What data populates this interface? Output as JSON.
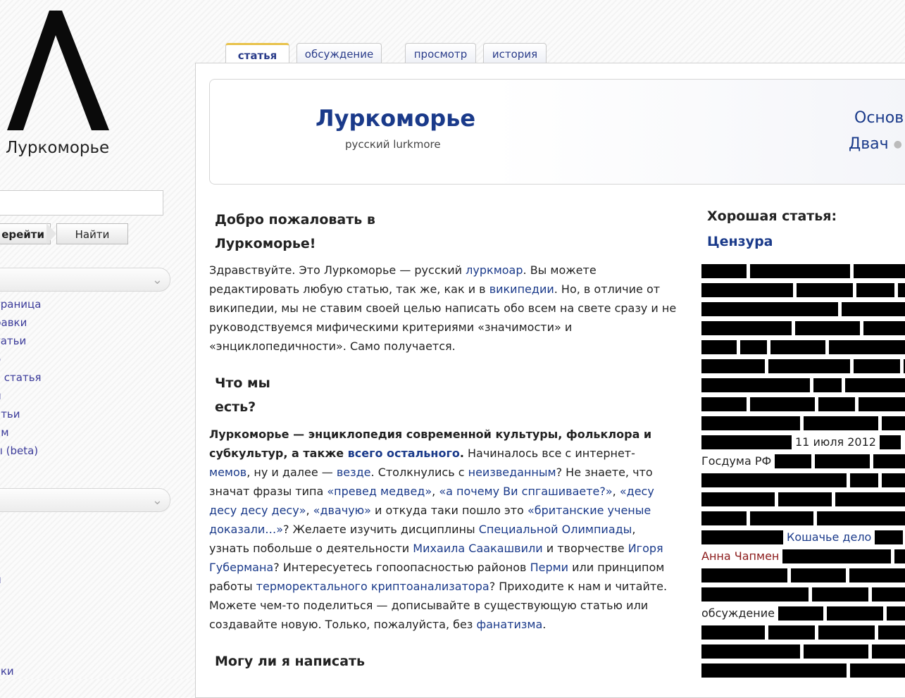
{
  "logo": {
    "text": "Луркоморье"
  },
  "search": {
    "go_label": "ерейти",
    "find_label": "Найти",
    "value": ""
  },
  "sidebar": {
    "nav": [
      "траница",
      "равки",
      "татьи",
      "о",
      "я статья",
      "и",
      "атьи",
      "ам",
      "ы (beta)"
    ],
    "solo1": "и",
    "solo2": "вки"
  },
  "tabs": {
    "article": "статья",
    "discussion": "обсуждение",
    "view": "просмотр",
    "history": "история"
  },
  "banner": {
    "title": "Луркоморье",
    "subtitle": "русский lurkmore",
    "right1": "Основ",
    "right2a": "Двач",
    "right2b": "Х"
  },
  "welcome": {
    "h1": "Добро пожаловать в",
    "h2": "Луркоморье!"
  },
  "intro": {
    "t1": "Здравствуйте. Это Луркоморье — русский ",
    "l1": "луркмоар",
    "t2": ". Вы можете редактировать любую статью, так же, как и в ",
    "l2": "википедии",
    "t3": ". Но, в отличие от википедии, мы не ставим своей целью написать обо всем на свете сразу и не руководствуемся мифическими критериями «значимости» и «энциклопедичности». Само получается."
  },
  "what": {
    "h1": "Что мы",
    "h2": "есть?"
  },
  "about": {
    "b1": "Луркоморье — энциклопедия современной культуры, фольклора и субкультур, а также ",
    "bl": "всего остального",
    "b2": ".",
    "t1": " Начиналось все с интернет-",
    "l1": "мемов",
    "t2": ", ну и далее — ",
    "l2": "везде",
    "t3": ". Столкнулись с ",
    "l3": "неизведанным",
    "t4": "? Не знаете, что значат фразы типа ",
    "l4": "«превед медвед»",
    "t5": ", ",
    "l5": "«а почему Ви спгашиваете?»",
    "t6": ", ",
    "l6": "«десу десу десу десу»",
    "t7": ", ",
    "l7": "«двачую»",
    "t8": " и откуда таки пошло это ",
    "l8": "«британские ученые доказали…»",
    "t9": "? Желаете изучить дисциплины ",
    "l9": "Специальной Олимпиады",
    "t10": ", узнать побольше о деятельности ",
    "l10": "Михаила Саакашвили",
    "t11": " и творчестве ",
    "l11": "Игоря Губермана",
    "t12": "? Интересуетесь гопоопасностью районов ",
    "l12": "Перми",
    "t13": " или принципом работы ",
    "l13": "терморектального криптоанализатора",
    "t14": "? Приходите к нам и читайте. Можете чем-то поделиться — дописывайте в существующую статью или создавайте новую. Только, пожалуйста, без ",
    "l14": "фанатизма",
    "t15": "."
  },
  "can": {
    "h": "Могу ли я написать"
  },
  "good": {
    "heading": "Хорошая статья:",
    "link": "Цензура",
    "date": "11 июля 2012",
    "duma": "Госдума РФ",
    "cat": "Кошачье дело",
    "anna": "Анна Чапмен",
    "disc": "обсуждение"
  },
  "colors": {
    "link": "#1a3a8a",
    "tab_accent": "#e8c24a",
    "anna": "#8b1a1a"
  }
}
